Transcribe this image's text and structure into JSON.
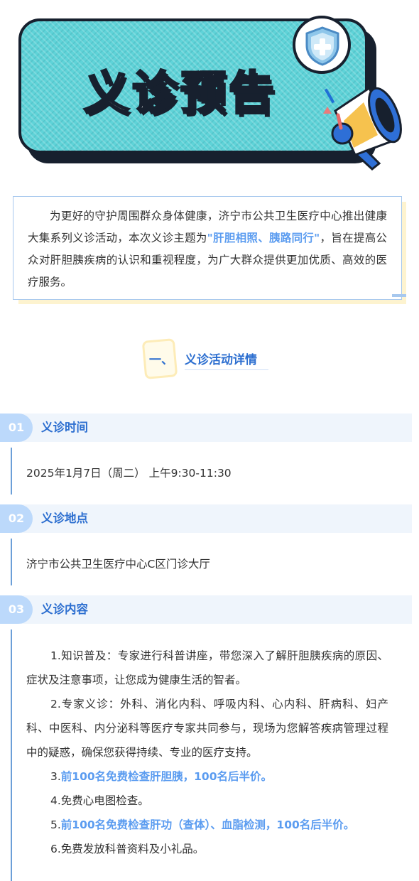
{
  "banner": {
    "title": "义诊预告",
    "shield_icon": "medical-shield-icon",
    "megaphone_icon": "megaphone-icon",
    "colors": {
      "card": "#5fd3d8",
      "outline": "#17202e"
    }
  },
  "intro": {
    "text_before": "为更好的守护周围群众身体健康，济宁市公共卫生医疗中心推出健康大集系列义诊活动，本次义诊主题为",
    "highlight": "\"肝胆相照、胰路同行\"",
    "text_after": "，旨在提高公众对肝胆胰疾病的认识和重视程度，为广大群众提供更加优质、高效的医疗服务。"
  },
  "section": {
    "number": "一、",
    "title": "义诊活动详情"
  },
  "items": [
    {
      "num": "01",
      "label": "义诊时间",
      "text": "2025年1月7日（周二） 上午9:30-11:30"
    },
    {
      "num": "02",
      "label": "义诊地点",
      "text": "济宁市公共卫生医疗中心C区门诊大厅"
    },
    {
      "num": "03",
      "label": "义诊内容"
    }
  ],
  "content": [
    {
      "text": "1.知识普及：专家进行科普讲座，带您深入了解肝胆胰疾病的原因、症状及注意事项，让您成为健康生活的智者。",
      "prefix": "",
      "bold": ""
    },
    {
      "text": "2.专家义诊：外科、消化内科、呼吸内科、心内科、肝病科、妇产科、中医科、内分泌科等医疗专家共同参与，现场为您解答疾病管理过程中的疑惑，确保您获得持续、专业的医疗支持。",
      "prefix": "",
      "bold": ""
    },
    {
      "text": "",
      "prefix": "3.",
      "bold": "前100名免费检查肝胆胰，100名后半价。"
    },
    {
      "text": "4.免费心电图检查。",
      "prefix": "",
      "bold": ""
    },
    {
      "text": "",
      "prefix": "5.",
      "bold": "前100名免费检查肝功（查体）、血脂检测，100名后半价。"
    },
    {
      "text": "6.免费发放科普资料及小礼品。",
      "prefix": "",
      "bold": ""
    }
  ],
  "colors": {
    "accent": "#2d6fd0",
    "highlight": "#5b9cf0",
    "badge": "#bcd9fb",
    "bar": "#eff5fc"
  }
}
